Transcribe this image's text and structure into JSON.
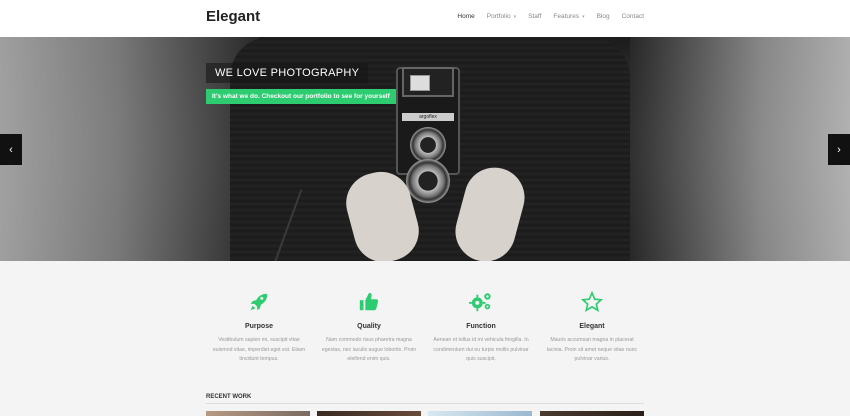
{
  "header": {
    "logo": "Elegant",
    "nav": [
      {
        "label": "Home",
        "has_caret": false,
        "active": true
      },
      {
        "label": "Portfolio",
        "has_caret": true,
        "active": false
      },
      {
        "label": "Staff",
        "has_caret": false,
        "active": false
      },
      {
        "label": "Features",
        "has_caret": true,
        "active": false
      },
      {
        "label": "Blog",
        "has_caret": false,
        "active": false
      },
      {
        "label": "Contact",
        "has_caret": false,
        "active": false
      }
    ]
  },
  "hero": {
    "title": "WE LOVE PHOTOGRAPHY",
    "subtitle": "It's what we do. Checkout our portfolio to see for yourself",
    "camera_brand": "argoflex",
    "prev_arrow": "‹",
    "next_arrow": "›"
  },
  "features": [
    {
      "icon": "rocket-icon",
      "title": "Purpose",
      "text": "Vestibulum sapien mi, suscipit vitae euismod vitae, imperdiet eget est. Etiam tincidunt tempus."
    },
    {
      "icon": "thumbs-up-icon",
      "title": "Quality",
      "text": "Nam commodo risus pharetra magna egestas, nec iaculis augue lobortis. Proin eleifend enim quis."
    },
    {
      "icon": "gears-icon",
      "title": "Function",
      "text": "Aenean et tellus id mi vehicula fringilla. In condimentum dui eu turpis mollis pulvinar quis suscipit."
    },
    {
      "icon": "star-icon",
      "title": "Elegant",
      "text": "Mauris accumsan magna in placerat lacinia. Proin sit amet neque vitae nunc pulvinar varius."
    }
  ],
  "recent_work": {
    "heading": "RECENT WORK"
  },
  "colors": {
    "accent": "#2ecc71",
    "icon_green": "#2ecc71"
  }
}
